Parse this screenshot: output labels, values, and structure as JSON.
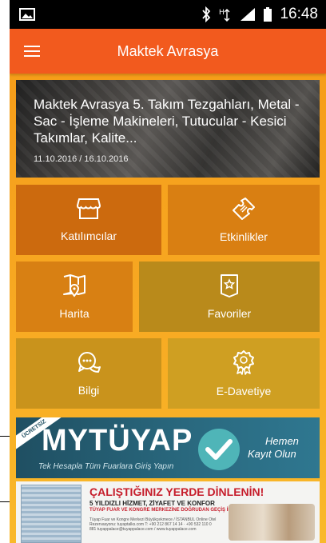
{
  "status_bar": {
    "time": "16:48",
    "icons": [
      "image-icon",
      "bluetooth-icon",
      "data-icon",
      "signal-icon",
      "battery-icon"
    ]
  },
  "app_bar": {
    "title": "Maktek Avrasya",
    "menu_icon": "hamburger-icon"
  },
  "hero": {
    "title": "Maktek Avrasya 5. Takım Tezgahları, Metal - Sac - İşleme Makineleri, Tutucular - Kesici Takımlar, Kalite...",
    "dates": "11.10.2016 / 16.10.2016"
  },
  "tiles": [
    {
      "label": "Katılımcılar",
      "icon": "store-icon"
    },
    {
      "label": "Etkinlikler",
      "icon": "ticket-icon"
    },
    {
      "label": "Harita",
      "icon": "map-pin-icon"
    },
    {
      "label": "Favoriler",
      "icon": "bookmark-star-icon"
    },
    {
      "label": "Bilgi",
      "icon": "chat-bubbles-icon"
    },
    {
      "label": "E-Davetiye",
      "icon": "badge-icon"
    }
  ],
  "banner_mytuyap": {
    "ribbon": "ÜCRETSİZ",
    "brand": "MYTÜYAP",
    "tagline": "Tek Hesapla Tüm Fuarlara Giriş Yapın",
    "cta_line1": "Hemen",
    "cta_line2": "Kayıt Olun"
  },
  "banner_hotel": {
    "headline": "ÇALIŞTIĞINIZ YERDE DİNLENİN!",
    "subline": "5 YILDIZLI HİZMET, ZİYAFET VE KONFOR",
    "detail": "TÜYAP FUAR VE KONGRE MERKEZİNE DOĞRUDAN GEÇİŞ İMKANI",
    "small": "Tüyap Fuar ve Kongre Merkezi Büyükçekmece / İSTANBUL Online Otel Rezervasyonu: tuyaptalks.com T: +90 212 867 14 14 · +90 532 110 0 881 tuyappalace@tuyappalace.com / www.tuyappalace.com"
  },
  "colors": {
    "app_bar": "#f25a1e",
    "status_bar": "#000000",
    "background_gradient_top": "#f59a16",
    "background_gradient_bottom": "#f9b92a"
  }
}
